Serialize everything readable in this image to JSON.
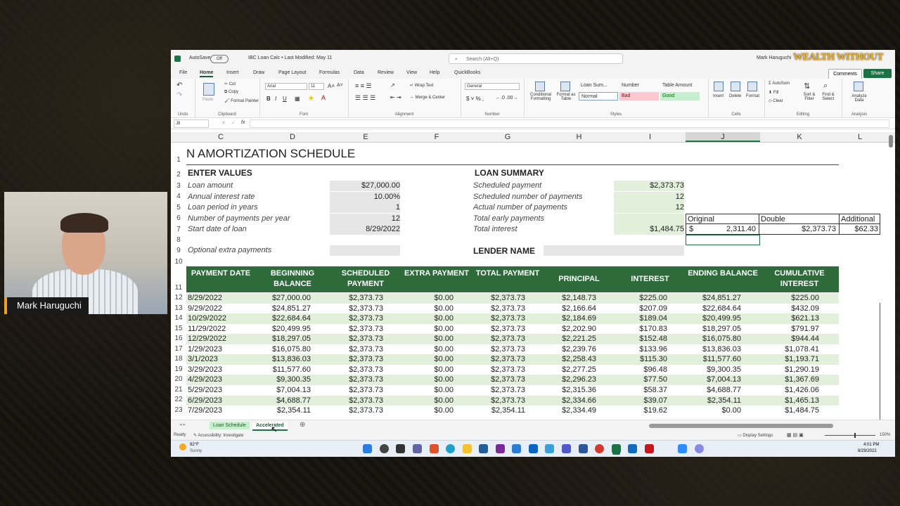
{
  "webcam": {
    "name": "Mark Haruguchi"
  },
  "window": {
    "autosave_label": "AutoSave",
    "autosave_state": "Off",
    "doc_title": "IBC Loan Calc • Last Modified: May 11",
    "search_placeholder": "Search (Alt+Q)",
    "user": "Mark Haruguchi",
    "logo": "WEALTH WITHOUT"
  },
  "ribbon_tabs": [
    "File",
    "Home",
    "Insert",
    "Draw",
    "Page Layout",
    "Formulas",
    "Data",
    "Review",
    "View",
    "Help",
    "QuickBooks"
  ],
  "ribbon_right": {
    "comments": "Comments",
    "share": "Share"
  },
  "ribbon": {
    "undo_label": "Undo",
    "clipboard": {
      "paste": "Paste",
      "cut": "Cut",
      "copy": "Copy",
      "format_painter": "Format Painter",
      "label": "Clipboard"
    },
    "font": {
      "name": "Arial",
      "size": "11",
      "label": "Font"
    },
    "alignment": {
      "wrap": "Wrap Text",
      "merge": "Merge & Center",
      "label": "Alignment"
    },
    "number": {
      "format": "General",
      "label": "Number"
    },
    "styles": {
      "cond": "Conditional Formatting",
      "fmt_table": "Format as Table",
      "cells": [
        {
          "name": "Loan Sum...",
          "bg": "#ffffff",
          "fg": "#333333"
        },
        {
          "name": "Number",
          "bg": "#ffffff",
          "fg": "#333333"
        },
        {
          "name": "Table Amount",
          "bg": "#ffffff",
          "fg": "#333333"
        },
        {
          "name": "Normal",
          "bg": "#ffffff",
          "fg": "#333333"
        },
        {
          "name": "Bad",
          "bg": "#ffc7ce",
          "fg": "#9c0006"
        },
        {
          "name": "Good",
          "bg": "#c6efce",
          "fg": "#006100"
        }
      ],
      "label": "Styles"
    },
    "cells": {
      "insert": "Insert",
      "delete": "Delete",
      "format": "Format",
      "label": "Cells"
    },
    "editing": {
      "autosum": "AutoSum",
      "fill": "Fill",
      "clear": "Clear",
      "sort": "Sort & Filter",
      "find": "Find & Select",
      "label": "Editing"
    },
    "analysis": {
      "analyze": "Analyze Data",
      "label": "Analysis"
    }
  },
  "formula_bar": {
    "namebox": "J8",
    "fx": "fx",
    "value": ""
  },
  "columns": [
    "C",
    "D",
    "E",
    "F",
    "G",
    "H",
    "I",
    "J",
    "K",
    "L"
  ],
  "rows": [
    "1",
    "2",
    "3",
    "4",
    "5",
    "6",
    "7",
    "8",
    "9",
    "10",
    "11",
    "12",
    "13",
    "14",
    "15",
    "16",
    "17",
    "18",
    "19",
    "20",
    "21",
    "22",
    "23"
  ],
  "sheet": {
    "title": "N AMORTIZATION SCHEDULE",
    "enter_values": "ENTER VALUES",
    "inputs": [
      {
        "label": "Loan amount",
        "value": "$27,000.00"
      },
      {
        "label": "Annual interest rate",
        "value": "10.00%"
      },
      {
        "label": "Loan period in years",
        "value": "1"
      },
      {
        "label": "Number of payments per year",
        "value": "12"
      },
      {
        "label": "Start date of loan",
        "value": "8/29/2022"
      }
    ],
    "optional_extra": "Optional extra payments",
    "loan_summary": "LOAN SUMMARY",
    "summary": [
      {
        "label": "Scheduled payment",
        "value": "$2,373.73"
      },
      {
        "label": "Scheduled number of payments",
        "value": "12"
      },
      {
        "label": "Actual number of payments",
        "value": "12"
      },
      {
        "label": "Total early payments",
        "value": ""
      },
      {
        "label": "Total interest",
        "value": "$1,484.75"
      }
    ],
    "lender_name": "LENDER NAME",
    "compare": {
      "headers": [
        "Original",
        "Double",
        "Additional"
      ],
      "values": [
        "$",
        "2,311.40",
        "$2,373.73",
        "$62.33"
      ]
    },
    "table_headers": [
      "PAYMENT DATE",
      "BEGINNING BALANCE",
      "SCHEDULED PAYMENT",
      "EXTRA PAYMENT",
      "TOTAL PAYMENT",
      "PRINCIPAL",
      "INTEREST",
      "ENDING BALANCE",
      "CUMULATIVE INTEREST"
    ],
    "table_rows": [
      [
        "8/29/2022",
        "$27,000.00",
        "$2,373.73",
        "$0.00",
        "$2,373.73",
        "$2,148.73",
        "$225.00",
        "$24,851.27",
        "$225.00"
      ],
      [
        "9/29/2022",
        "$24,851.27",
        "$2,373.73",
        "$0.00",
        "$2,373.73",
        "$2,166.64",
        "$207.09",
        "$22,684.64",
        "$432.09"
      ],
      [
        "10/29/2022",
        "$22,684.64",
        "$2,373.73",
        "$0.00",
        "$2,373.73",
        "$2,184.69",
        "$189.04",
        "$20,499.95",
        "$621.13"
      ],
      [
        "11/29/2022",
        "$20,499.95",
        "$2,373.73",
        "$0.00",
        "$2,373.73",
        "$2,202.90",
        "$170.83",
        "$18,297.05",
        "$791.97"
      ],
      [
        "12/29/2022",
        "$18,297.05",
        "$2,373.73",
        "$0.00",
        "$2,373.73",
        "$2,221.25",
        "$152.48",
        "$16,075.80",
        "$944.44"
      ],
      [
        "1/29/2023",
        "$16,075.80",
        "$2,373.73",
        "$0.00",
        "$2,373.73",
        "$2,239.76",
        "$133.96",
        "$13,836.03",
        "$1,078.41"
      ],
      [
        "3/1/2023",
        "$13,836.03",
        "$2,373.73",
        "$0.00",
        "$2,373.73",
        "$2,258.43",
        "$115.30",
        "$11,577.60",
        "$1,193.71"
      ],
      [
        "3/29/2023",
        "$11,577.60",
        "$2,373.73",
        "$0.00",
        "$2,373.73",
        "$2,277.25",
        "$96.48",
        "$9,300.35",
        "$1,290.19"
      ],
      [
        "4/29/2023",
        "$9,300.35",
        "$2,373.73",
        "$0.00",
        "$2,373.73",
        "$2,296.23",
        "$77.50",
        "$7,004.13",
        "$1,367.69"
      ],
      [
        "5/29/2023",
        "$7,004.13",
        "$2,373.73",
        "$0.00",
        "$2,373.73",
        "$2,315.36",
        "$58.37",
        "$4,688.77",
        "$1,426.06"
      ],
      [
        "6/29/2023",
        "$4,688.77",
        "$2,373.73",
        "$0.00",
        "$2,373.73",
        "$2,334.66",
        "$39.07",
        "$2,354.11",
        "$1,465.13"
      ],
      [
        "7/29/2023",
        "$2,354.11",
        "$2,373.73",
        "$0.00",
        "$2,354.11",
        "$2,334.49",
        "$19.62",
        "$0.00",
        "$1,484.75"
      ]
    ]
  },
  "sheet_tabs": [
    "Loan Schedule",
    "Accelerated"
  ],
  "status": {
    "ready": "Ready",
    "accessibility": "Accessibility: Investigate",
    "display": "Display Settings",
    "zoom": "150%"
  },
  "taskbar": {
    "temp": "92°F",
    "weather": "Sunny",
    "time": "4:01 PM",
    "date": "8/29/2022"
  },
  "colors": {
    "header_green": "#2f6b3a",
    "band_green": "#e2efda",
    "input_gray": "#e6e6e6",
    "excel_green": "#1e7145"
  }
}
